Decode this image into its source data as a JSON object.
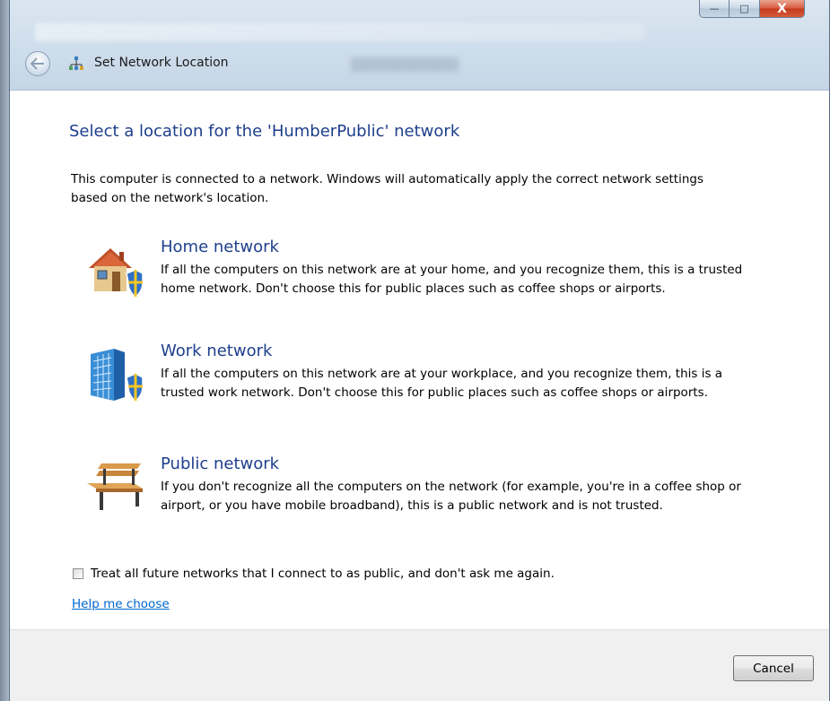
{
  "window": {
    "title": "Set Network Location",
    "caption_buttons": {
      "minimize": "—",
      "maximize": "□",
      "close": "X"
    }
  },
  "content": {
    "heading": "Select a location for the 'HumberPublic' network",
    "intro": "This computer is connected to a network. Windows will automatically apply the correct network settings based on the network's location.",
    "options": [
      {
        "title": "Home network",
        "description": "If all the computers on this network are at your home, and you recognize them, this is a trusted home network.  Don't choose this for public places such as coffee shops or airports.",
        "icon": "home-network-icon"
      },
      {
        "title": "Work network",
        "description": "If all the computers on this network are at your workplace, and you recognize them, this is a trusted work network.  Don't choose this for public places such as coffee shops or airports.",
        "icon": "work-network-icon"
      },
      {
        "title": "Public network",
        "description": "If you don't recognize all the computers on the network (for example, you're in a coffee shop or airport, or you have mobile broadband), this is a public network and is not trusted.",
        "icon": "public-network-icon"
      }
    ],
    "checkbox": {
      "label": "Treat all future networks that I connect to as public, and don't ask me again.",
      "checked": false
    },
    "help_link": "Help me choose"
  },
  "footer": {
    "cancel_label": "Cancel"
  },
  "colors": {
    "heading": "#1e3f8c",
    "link": "#0066cc",
    "footer_bg": "#f0f0f0"
  }
}
